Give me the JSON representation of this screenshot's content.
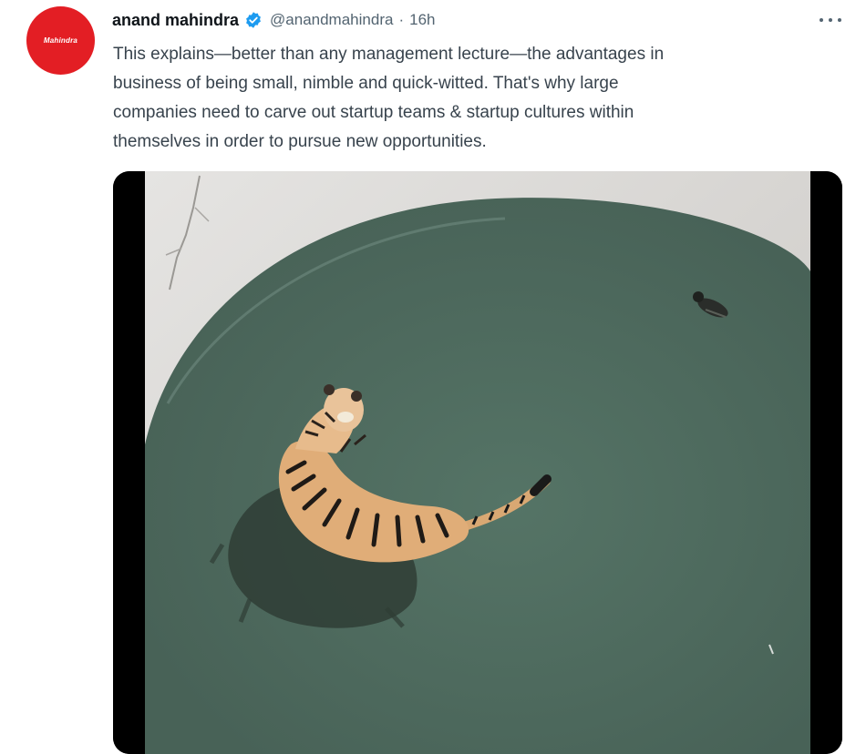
{
  "tweet": {
    "author": {
      "name": "anand mahindra",
      "handle": "@anandmahindra",
      "verified": true,
      "avatar_logo_text": "Mahindra",
      "avatar_color": "#e31e24"
    },
    "separator": "·",
    "timestamp": "16h",
    "more_icon": "more-horizontal-icon",
    "text_lines": [
      "This explains—better than any management lecture—the advantages in",
      "business of being small, nimble and quick-witted. That's why large",
      "companies need to carve out startup teams & startup cultures within",
      "themselves in order to pursue new opportunities."
    ],
    "media": {
      "type": "video-still",
      "content": "tiger-in-water-pool-with-duck"
    },
    "colors": {
      "verified_badge": "#1d9bf0",
      "text": "#38434d",
      "secondary_text": "#536471",
      "water": "#4f6b62"
    }
  }
}
